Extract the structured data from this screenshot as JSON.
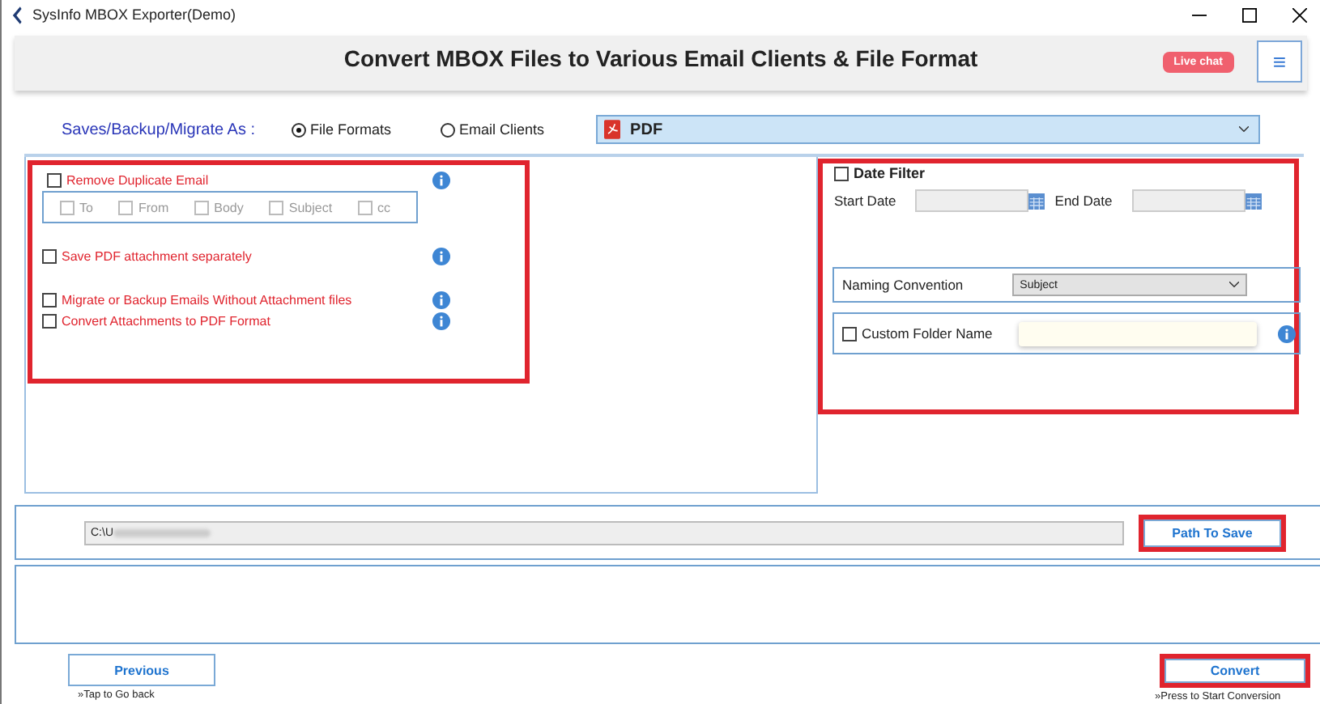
{
  "window": {
    "title": "SysInfo MBOX Exporter(Demo)"
  },
  "header": {
    "title": "Convert MBOX Files to Various Email Clients & File Format",
    "live_chat": "Live chat",
    "menu": "≡"
  },
  "save_as": {
    "label": "Saves/Backup/Migrate As :",
    "options": [
      {
        "label": "File Formats",
        "selected": true
      },
      {
        "label": "Email Clients",
        "selected": false
      }
    ],
    "format": "PDF"
  },
  "left_options": [
    {
      "label": "Remove Duplicate Email",
      "checked": false,
      "info": true,
      "sub": [
        {
          "label": "To",
          "checked": false
        },
        {
          "label": "From",
          "checked": false
        },
        {
          "label": "Body",
          "checked": false
        },
        {
          "label": "Subject",
          "checked": false
        },
        {
          "label": "cc",
          "checked": false
        }
      ]
    },
    {
      "label": "Save PDF attachment separately",
      "checked": false,
      "info": true
    },
    {
      "label": "Migrate or Backup Emails Without Attachment files",
      "checked": false,
      "info": true
    },
    {
      "label": "Convert Attachments to PDF Format",
      "checked": false,
      "info": true
    }
  ],
  "date_filter": {
    "label": "Date Filter",
    "checked": false,
    "start_label": "Start Date",
    "end_label": "End Date"
  },
  "naming": {
    "label": "Naming Convention",
    "value": "Subject"
  },
  "custom_folder": {
    "label": "Custom Folder Name",
    "checked": false
  },
  "path": {
    "value": "C:\\U",
    "button": "Path To Save"
  },
  "footer": {
    "previous": "Previous",
    "previous_hint": "»Tap to Go back",
    "convert": "Convert",
    "convert_hint": "»Press to Start Conversion"
  }
}
